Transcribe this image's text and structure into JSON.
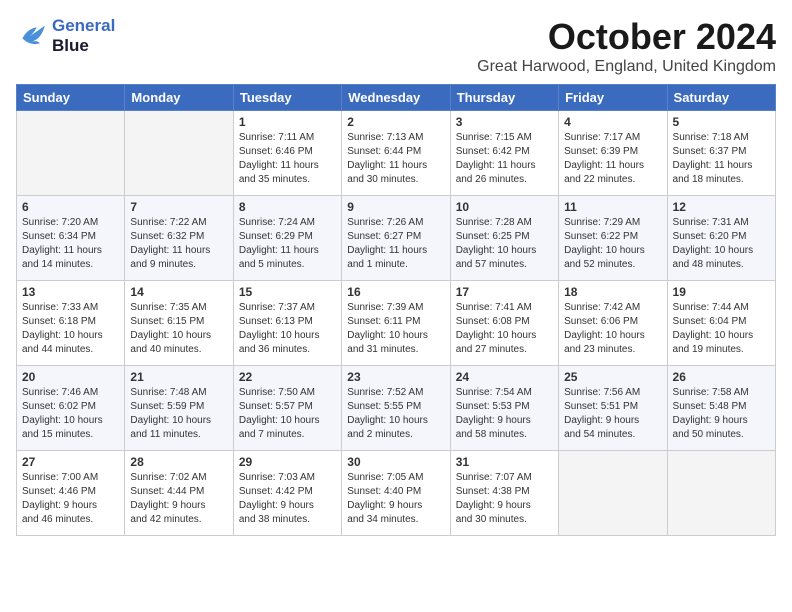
{
  "logo": {
    "line1": "General",
    "line2": "Blue"
  },
  "title": "October 2024",
  "location": "Great Harwood, England, United Kingdom",
  "days_of_week": [
    "Sunday",
    "Monday",
    "Tuesday",
    "Wednesday",
    "Thursday",
    "Friday",
    "Saturday"
  ],
  "weeks": [
    [
      {
        "day": "",
        "info": ""
      },
      {
        "day": "",
        "info": ""
      },
      {
        "day": "1",
        "info": "Sunrise: 7:11 AM\nSunset: 6:46 PM\nDaylight: 11 hours\nand 35 minutes."
      },
      {
        "day": "2",
        "info": "Sunrise: 7:13 AM\nSunset: 6:44 PM\nDaylight: 11 hours\nand 30 minutes."
      },
      {
        "day": "3",
        "info": "Sunrise: 7:15 AM\nSunset: 6:42 PM\nDaylight: 11 hours\nand 26 minutes."
      },
      {
        "day": "4",
        "info": "Sunrise: 7:17 AM\nSunset: 6:39 PM\nDaylight: 11 hours\nand 22 minutes."
      },
      {
        "day": "5",
        "info": "Sunrise: 7:18 AM\nSunset: 6:37 PM\nDaylight: 11 hours\nand 18 minutes."
      }
    ],
    [
      {
        "day": "6",
        "info": "Sunrise: 7:20 AM\nSunset: 6:34 PM\nDaylight: 11 hours\nand 14 minutes."
      },
      {
        "day": "7",
        "info": "Sunrise: 7:22 AM\nSunset: 6:32 PM\nDaylight: 11 hours\nand 9 minutes."
      },
      {
        "day": "8",
        "info": "Sunrise: 7:24 AM\nSunset: 6:29 PM\nDaylight: 11 hours\nand 5 minutes."
      },
      {
        "day": "9",
        "info": "Sunrise: 7:26 AM\nSunset: 6:27 PM\nDaylight: 11 hours\nand 1 minute."
      },
      {
        "day": "10",
        "info": "Sunrise: 7:28 AM\nSunset: 6:25 PM\nDaylight: 10 hours\nand 57 minutes."
      },
      {
        "day": "11",
        "info": "Sunrise: 7:29 AM\nSunset: 6:22 PM\nDaylight: 10 hours\nand 52 minutes."
      },
      {
        "day": "12",
        "info": "Sunrise: 7:31 AM\nSunset: 6:20 PM\nDaylight: 10 hours\nand 48 minutes."
      }
    ],
    [
      {
        "day": "13",
        "info": "Sunrise: 7:33 AM\nSunset: 6:18 PM\nDaylight: 10 hours\nand 44 minutes."
      },
      {
        "day": "14",
        "info": "Sunrise: 7:35 AM\nSunset: 6:15 PM\nDaylight: 10 hours\nand 40 minutes."
      },
      {
        "day": "15",
        "info": "Sunrise: 7:37 AM\nSunset: 6:13 PM\nDaylight: 10 hours\nand 36 minutes."
      },
      {
        "day": "16",
        "info": "Sunrise: 7:39 AM\nSunset: 6:11 PM\nDaylight: 10 hours\nand 31 minutes."
      },
      {
        "day": "17",
        "info": "Sunrise: 7:41 AM\nSunset: 6:08 PM\nDaylight: 10 hours\nand 27 minutes."
      },
      {
        "day": "18",
        "info": "Sunrise: 7:42 AM\nSunset: 6:06 PM\nDaylight: 10 hours\nand 23 minutes."
      },
      {
        "day": "19",
        "info": "Sunrise: 7:44 AM\nSunset: 6:04 PM\nDaylight: 10 hours\nand 19 minutes."
      }
    ],
    [
      {
        "day": "20",
        "info": "Sunrise: 7:46 AM\nSunset: 6:02 PM\nDaylight: 10 hours\nand 15 minutes."
      },
      {
        "day": "21",
        "info": "Sunrise: 7:48 AM\nSunset: 5:59 PM\nDaylight: 10 hours\nand 11 minutes."
      },
      {
        "day": "22",
        "info": "Sunrise: 7:50 AM\nSunset: 5:57 PM\nDaylight: 10 hours\nand 7 minutes."
      },
      {
        "day": "23",
        "info": "Sunrise: 7:52 AM\nSunset: 5:55 PM\nDaylight: 10 hours\nand 2 minutes."
      },
      {
        "day": "24",
        "info": "Sunrise: 7:54 AM\nSunset: 5:53 PM\nDaylight: 9 hours\nand 58 minutes."
      },
      {
        "day": "25",
        "info": "Sunrise: 7:56 AM\nSunset: 5:51 PM\nDaylight: 9 hours\nand 54 minutes."
      },
      {
        "day": "26",
        "info": "Sunrise: 7:58 AM\nSunset: 5:48 PM\nDaylight: 9 hours\nand 50 minutes."
      }
    ],
    [
      {
        "day": "27",
        "info": "Sunrise: 7:00 AM\nSunset: 4:46 PM\nDaylight: 9 hours\nand 46 minutes."
      },
      {
        "day": "28",
        "info": "Sunrise: 7:02 AM\nSunset: 4:44 PM\nDaylight: 9 hours\nand 42 minutes."
      },
      {
        "day": "29",
        "info": "Sunrise: 7:03 AM\nSunset: 4:42 PM\nDaylight: 9 hours\nand 38 minutes."
      },
      {
        "day": "30",
        "info": "Sunrise: 7:05 AM\nSunset: 4:40 PM\nDaylight: 9 hours\nand 34 minutes."
      },
      {
        "day": "31",
        "info": "Sunrise: 7:07 AM\nSunset: 4:38 PM\nDaylight: 9 hours\nand 30 minutes."
      },
      {
        "day": "",
        "info": ""
      },
      {
        "day": "",
        "info": ""
      }
    ]
  ]
}
